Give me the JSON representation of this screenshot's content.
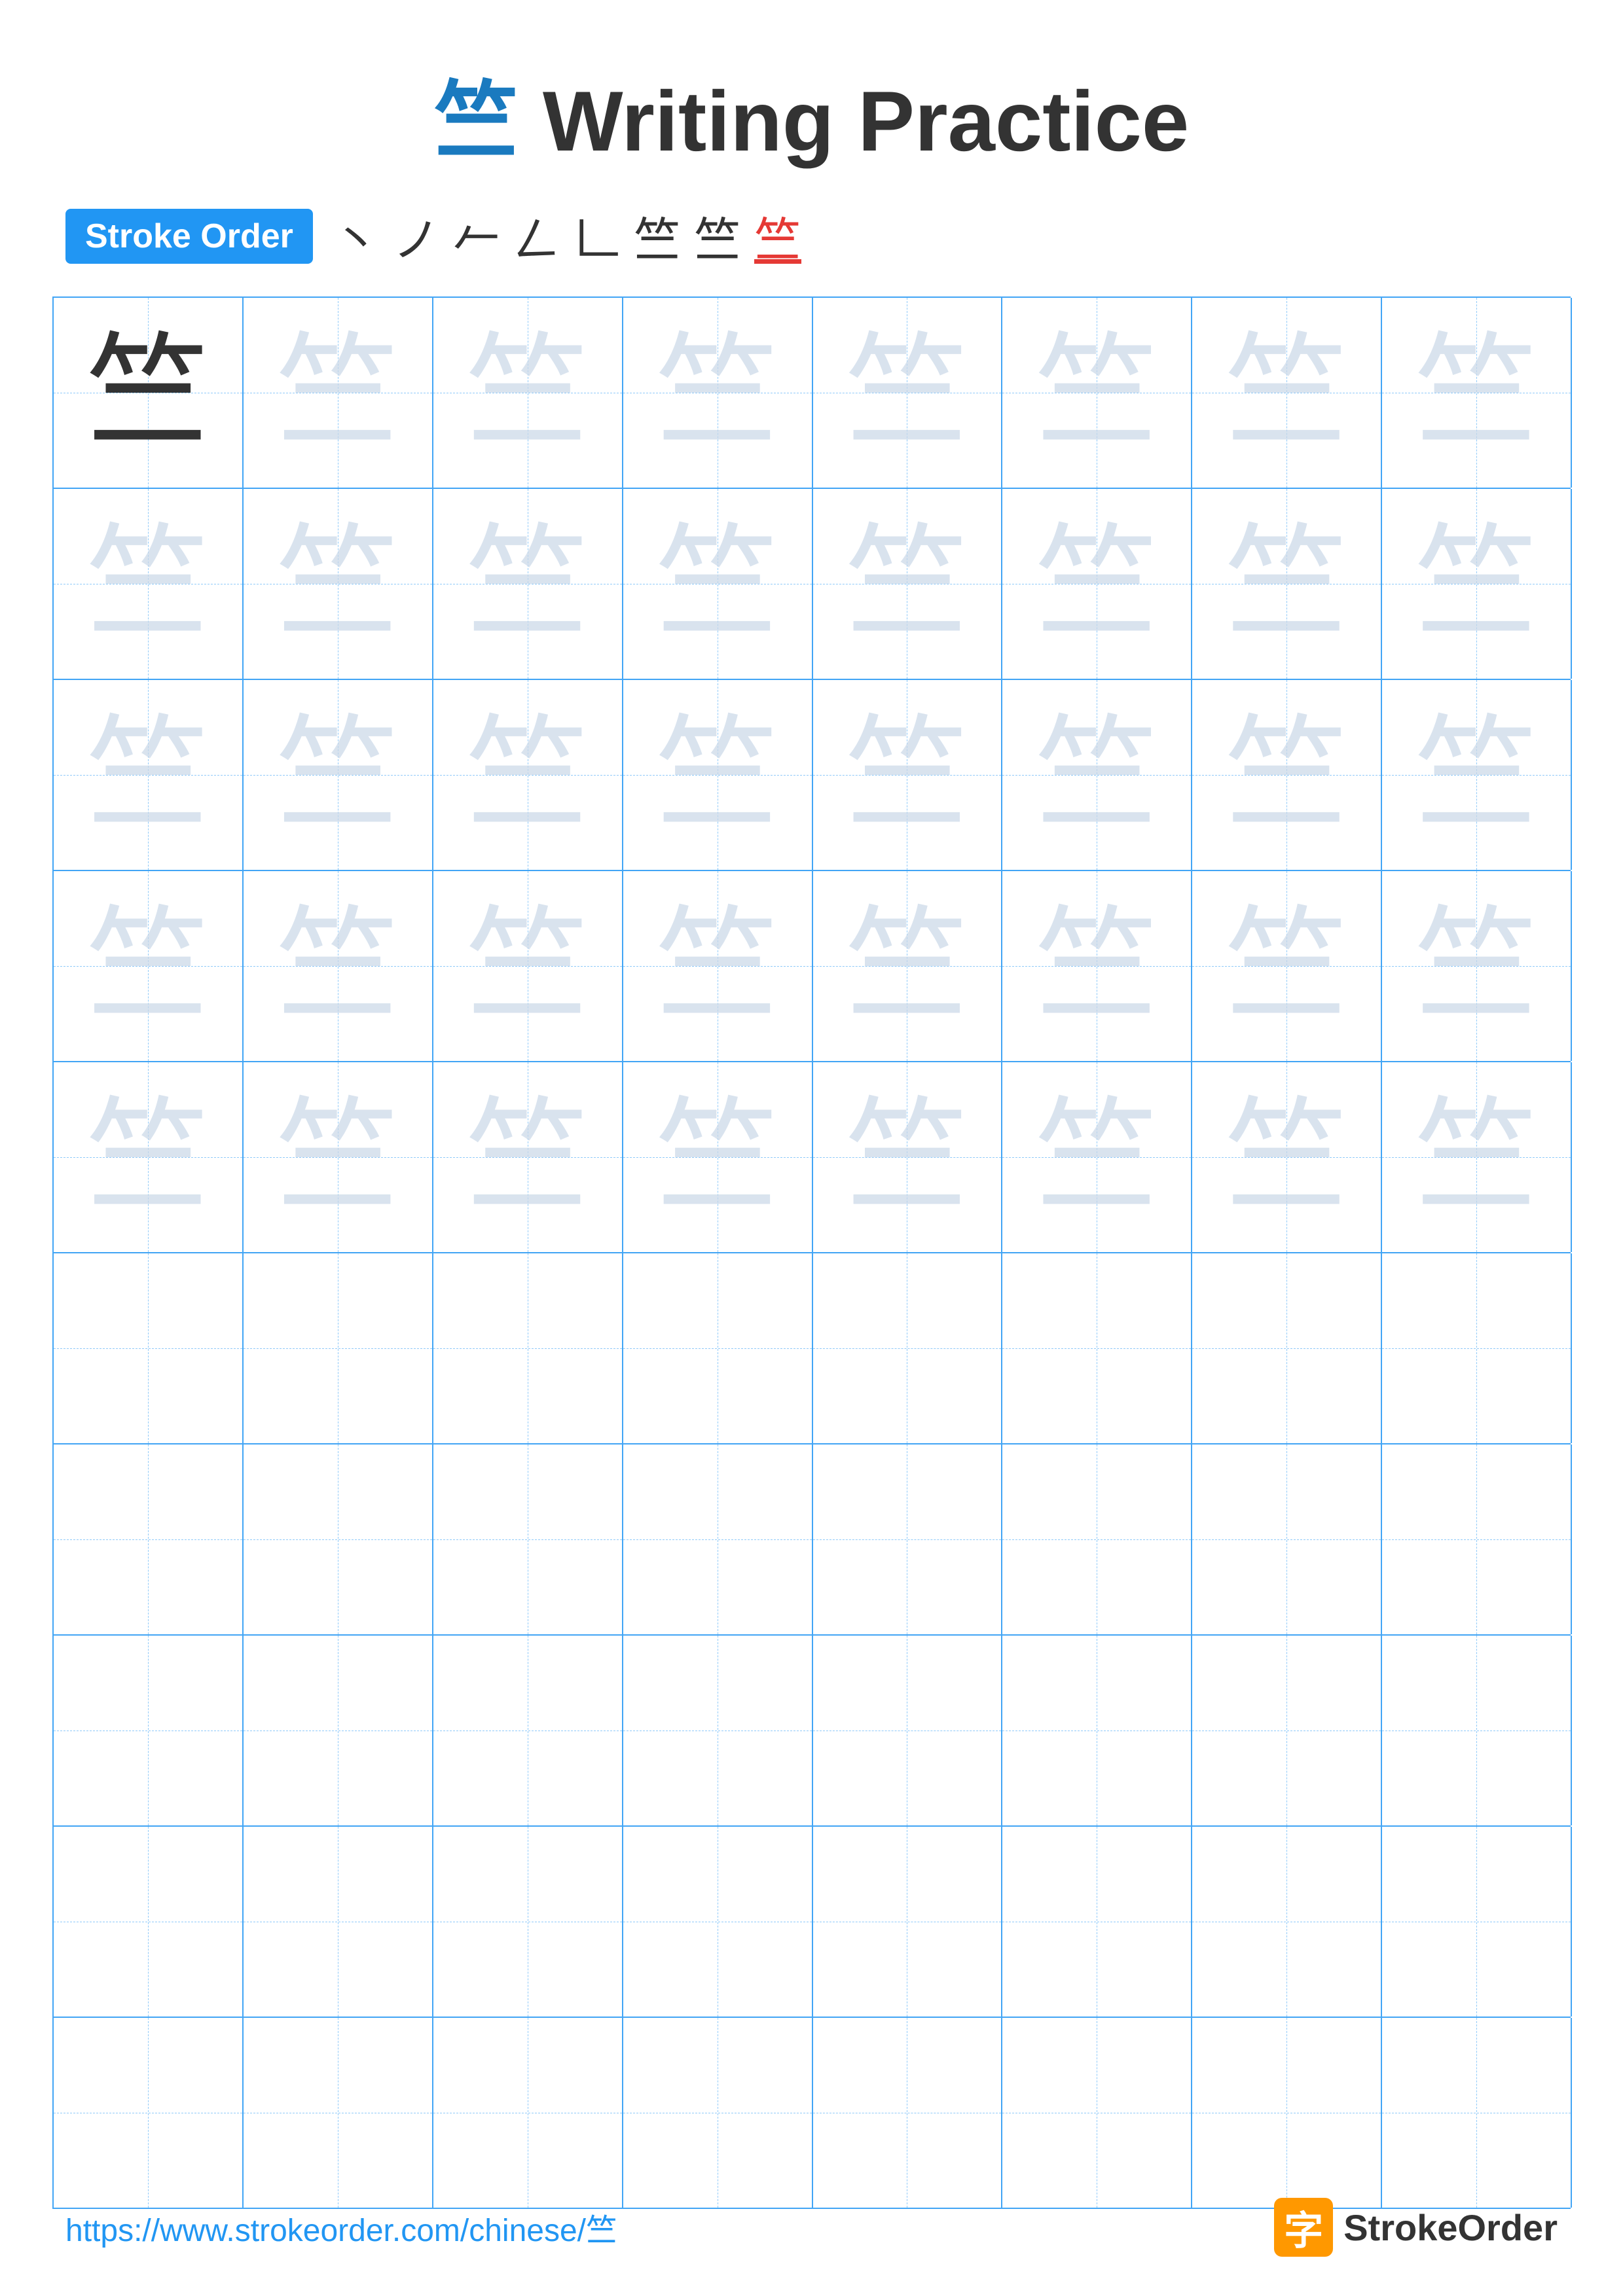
{
  "header": {
    "char": "竺",
    "title": "Writing Practice"
  },
  "stroke_order": {
    "badge_label": "Stroke Order",
    "strokes": [
      "丶",
      "ノ",
      "𠂉",
      "𠃋",
      "𠃊",
      "竺",
      "竺",
      "竺"
    ]
  },
  "grid": {
    "rows": 10,
    "cols": 8,
    "char": "竺",
    "practice_rows": 5,
    "empty_rows": 5
  },
  "footer": {
    "url": "https://www.strokeorder.com/chinese/竺",
    "brand_label": "StrokeOrder"
  }
}
